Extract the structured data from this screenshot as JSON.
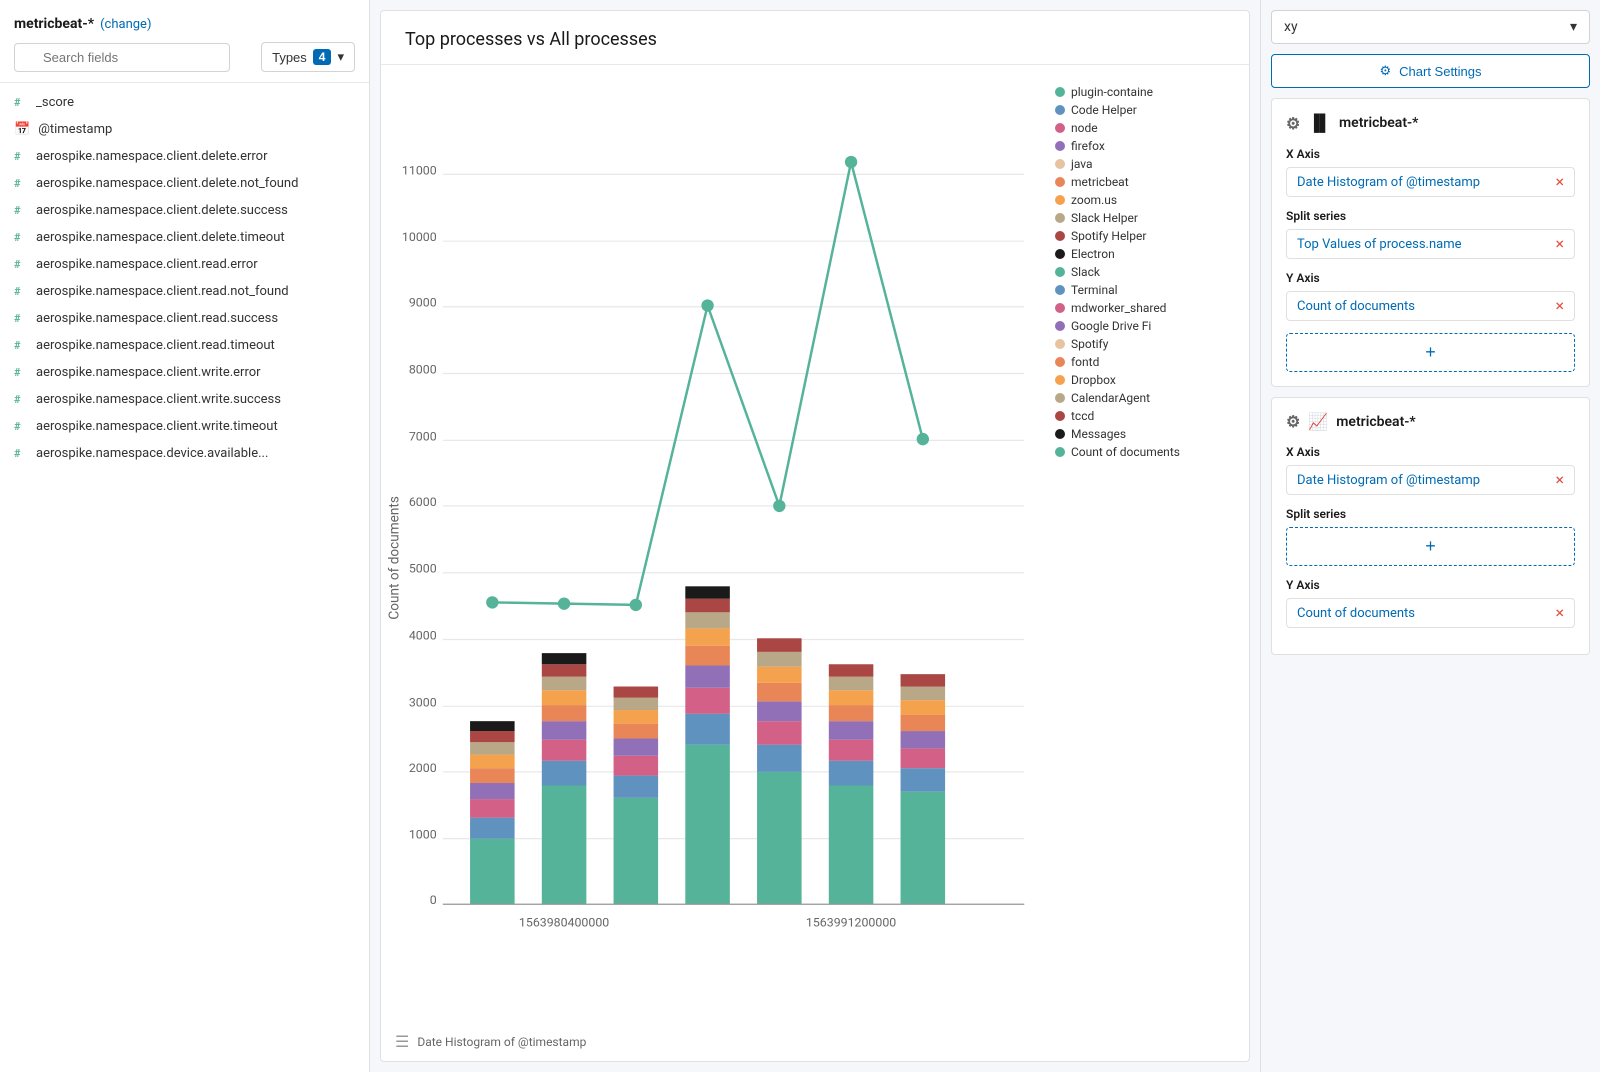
{
  "sidebar": {
    "index_pattern": "metricbeat-*",
    "change_label": "(change)",
    "search_placeholder": "Search fields",
    "types_label": "Types",
    "types_count": "4",
    "fields": [
      {
        "icon": "#",
        "icon_type": "number",
        "name": "_score"
      },
      {
        "icon": "📅",
        "icon_type": "date",
        "name": "@timestamp"
      },
      {
        "icon": "#",
        "icon_type": "number",
        "name": "aerospike.namespace.client.delete.error"
      },
      {
        "icon": "#",
        "icon_type": "number",
        "name": "aerospike.namespace.client.delete.not_found"
      },
      {
        "icon": "#",
        "icon_type": "number",
        "name": "aerospike.namespace.client.delete.success"
      },
      {
        "icon": "#",
        "icon_type": "number",
        "name": "aerospike.namespace.client.delete.timeout"
      },
      {
        "icon": "#",
        "icon_type": "number",
        "name": "aerospike.namespace.client.read.error"
      },
      {
        "icon": "#",
        "icon_type": "number",
        "name": "aerospike.namespace.client.read.not_found"
      },
      {
        "icon": "#",
        "icon_type": "number",
        "name": "aerospike.namespace.client.read.success"
      },
      {
        "icon": "#",
        "icon_type": "number",
        "name": "aerospike.namespace.client.read.timeout"
      },
      {
        "icon": "#",
        "icon_type": "number",
        "name": "aerospike.namespace.client.write.error"
      },
      {
        "icon": "#",
        "icon_type": "number",
        "name": "aerospike.namespace.client.write.success"
      },
      {
        "icon": "#",
        "icon_type": "number",
        "name": "aerospike.namespace.client.write.timeout"
      },
      {
        "icon": "#",
        "icon_type": "number",
        "name": "aerospike.namespace.device.available..."
      }
    ]
  },
  "chart": {
    "title": "Top processes vs All processes",
    "x_label": "Date Histogram of @timestamp",
    "y_label": "Count of documents",
    "x_ticks": [
      "1563980400000",
      "1563991200000"
    ],
    "y_ticks": [
      "0",
      "1000",
      "2000",
      "3000",
      "4000",
      "5000",
      "6000",
      "7000",
      "8000",
      "9000",
      "10000",
      "11000"
    ],
    "legend": [
      {
        "name": "plugin-containe",
        "color": "#54b399"
      },
      {
        "name": "Code Helper",
        "color": "#6092c0"
      },
      {
        "name": "node",
        "color": "#d36086"
      },
      {
        "name": "firefox",
        "color": "#9170b8"
      },
      {
        "name": "java",
        "color": "#e7c39f"
      },
      {
        "name": "metricbeat",
        "color": "#e88657"
      },
      {
        "name": "zoom.us",
        "color": "#f5a24e"
      },
      {
        "name": "Slack Helper",
        "color": "#b9a888"
      },
      {
        "name": "Spotify Helper",
        "color": "#aa4643"
      },
      {
        "name": "Electron",
        "color": "#1a1a1a"
      },
      {
        "name": "Slack",
        "color": "#54b399"
      },
      {
        "name": "Terminal",
        "color": "#6092c0"
      },
      {
        "name": "mdworker_shared",
        "color": "#d36086"
      },
      {
        "name": "Google Drive Fi",
        "color": "#9170b8"
      },
      {
        "name": "Spotify",
        "color": "#e7c39f"
      },
      {
        "name": "fontd",
        "color": "#e88657"
      },
      {
        "name": "Dropbox",
        "color": "#f5a24e"
      },
      {
        "name": "CalendarAgent",
        "color": "#b9a888"
      },
      {
        "name": "tccd",
        "color": "#aa4643"
      },
      {
        "name": "Messages",
        "color": "#1a1a1a"
      },
      {
        "name": "Count of documents",
        "color": "#54b399"
      }
    ]
  },
  "right_panel": {
    "xy_label": "xy",
    "chart_settings_label": "Chart Settings",
    "card1": {
      "title": "metricbeat-*",
      "x_axis_label": "X Axis",
      "x_axis_value": "Date Histogram of @timestamp",
      "split_series_label": "Split series",
      "split_series_value": "Top Values of process.name",
      "y_axis_label": "Y Axis",
      "y_axis_value": "Count of documents"
    },
    "card2": {
      "title": "metricbeat-*",
      "x_axis_label": "X Axis",
      "x_axis_value": "Date Histogram of @timestamp",
      "split_series_label": "Split series",
      "y_axis_label": "Y Axis",
      "y_axis_value": "Count of documents"
    },
    "add_label": "+",
    "remove_label": "×"
  }
}
